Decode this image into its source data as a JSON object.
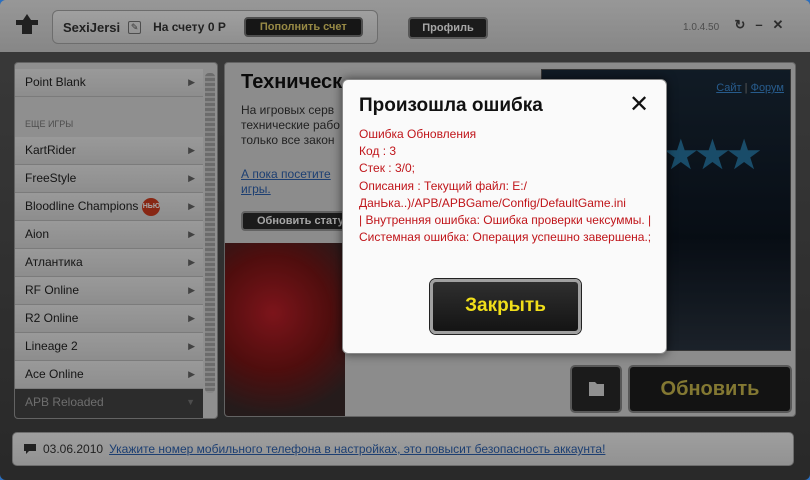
{
  "topbar": {
    "username": "SexiJersi",
    "balance": "На счету 0  Р",
    "topup_label": "Пополнить счет",
    "profile_label": "Профиль",
    "version": "1.0.4.50"
  },
  "sidebar": {
    "items": [
      {
        "label": "Point Blank"
      },
      {
        "label": "KartRider"
      },
      {
        "label": "FreeStyle"
      },
      {
        "label": "Bloodline Champions",
        "badge": "НЬЮ"
      },
      {
        "label": "Aion"
      },
      {
        "label": "Атлантика"
      },
      {
        "label": "RF Online"
      },
      {
        "label": "R2 Online"
      },
      {
        "label": "Lineage 2"
      },
      {
        "label": "Ace Online"
      },
      {
        "label": "APB Reloaded"
      }
    ],
    "section_label": "ЕЩЕ ИГРЫ"
  },
  "main": {
    "heading": "Техническ",
    "text": "На игровых серв технические рабо только все закон",
    "link": "А пока посетите игры.",
    "status_button": "Обновить стату",
    "banner_links": {
      "site": "Сайт",
      "forum": "Форум"
    },
    "update_button": "Обновить"
  },
  "news": {
    "date": "03.06.2010",
    "message": "Укажите номер мобильного телефона в настройках, это повысит безопасность аккаунта!"
  },
  "dialog": {
    "title": "Произошла ошибка",
    "lines": [
      "Ошибка Обновления",
      "Код : 3",
      "Стек : 3/0;",
      "Описания : Текущий файл: E:/ДанЬка..)/APB/APBGame/Config/DefaultGame.ini",
      "| Внутренняя ошибка: Ошибка проверки чексуммы. | Системная ошибка: Операция успешно завершена.;"
    ],
    "close_button": "Закрыть"
  },
  "colors": {
    "error_text": "#c0151a",
    "button_text": "#f0de1a",
    "link": "#2d62b0"
  },
  "icons": [
    "logo-icon",
    "edit-icon",
    "restart-icon",
    "close-window-icon",
    "folder-icon",
    "chat-icon",
    "close-icon"
  ]
}
